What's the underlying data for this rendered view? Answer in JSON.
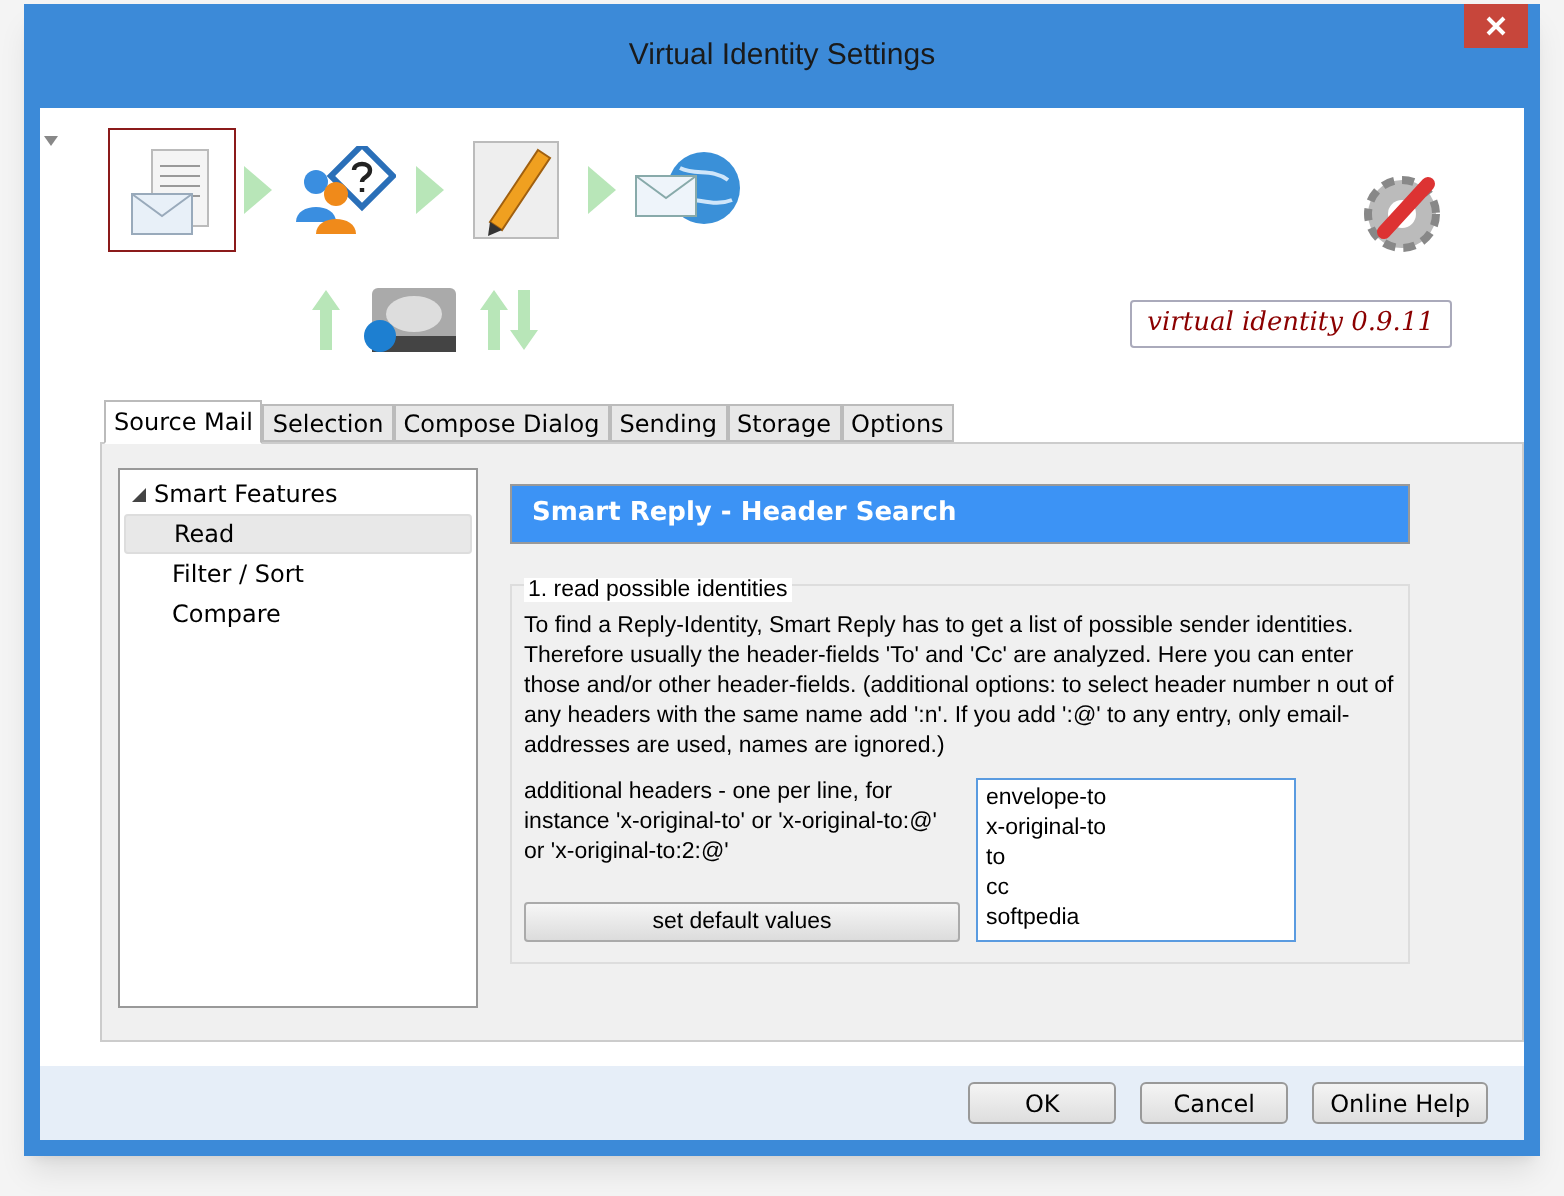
{
  "window": {
    "title": "Virtual Identity Settings"
  },
  "workflow": [
    {
      "kind": "document",
      "selected": true
    },
    {
      "kind": "users",
      "selected": false
    },
    {
      "kind": "pencil",
      "selected": false
    },
    {
      "kind": "globe",
      "selected": false
    }
  ],
  "version": "virtual identity 0.9.11",
  "tabs": [
    {
      "label": "Source Mail",
      "selected": true
    },
    {
      "label": "Selection",
      "selected": false
    },
    {
      "label": "Compose Dialog",
      "selected": false
    },
    {
      "label": "Sending",
      "selected": false
    },
    {
      "label": "Storage",
      "selected": false
    },
    {
      "label": "Options",
      "selected": false
    }
  ],
  "tree": [
    {
      "label": "Smart Features",
      "expanded": true,
      "selected": false,
      "children": [
        {
          "label": "Read",
          "selected": true
        },
        {
          "label": "Filter / Sort",
          "selected": false
        },
        {
          "label": "Compare",
          "selected": false
        }
      ]
    }
  ],
  "panel": {
    "title": "Smart Reply - Header Search",
    "group": {
      "legend": "1. read possible identities",
      "description": "To find a Reply-Identity, Smart Reply has to get a list of possible sender identities. Therefore usually the header-fields 'To' and 'Cc' are analyzed. Here you can enter those and/or other header-fields. (additional options: to select header number n out of any headers with the same name add ':n'. If you add ':@' to any entry, only email-addresses are used, names are ignored.)",
      "headers_label": "additional headers - one per line, for instance 'x-original-to' or 'x-original-to:@' or 'x-original-to:2:@'",
      "headers_value": [
        "envelope-to",
        "x-original-to",
        "to",
        "cc",
        "softpedia"
      ],
      "default_button": "set default values"
    }
  },
  "buttons": [
    "OK",
    "Cancel",
    "Online Help"
  ]
}
